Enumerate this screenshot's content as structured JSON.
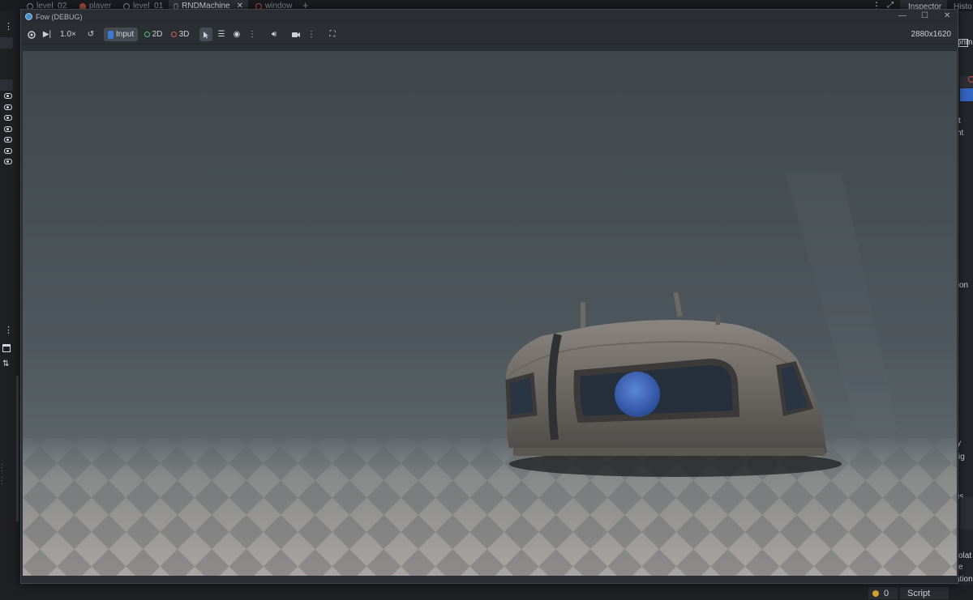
{
  "editor_tabs": [
    {
      "label": "level_02",
      "icon": "scene-icon"
    },
    {
      "label": "player",
      "icon": "person-icon"
    },
    {
      "label": "level_01",
      "icon": "scene-icon"
    },
    {
      "label": "RNDMachine",
      "icon": "scene-icon",
      "active": true,
      "close": "✕"
    },
    {
      "label": "window",
      "icon": "scene-icon-red"
    }
  ],
  "dock_tabs": {
    "inspector": "Inspector",
    "history": "Histo"
  },
  "window": {
    "title": "Fow (DEBUG)",
    "minimize": "—",
    "maximize": "☐",
    "close": "✕"
  },
  "toolbar": {
    "speed": "1.0×",
    "input_label": "Input",
    "mode_2d": "2D",
    "mode_3d": "3D",
    "resolution": "2880x1620"
  },
  "right_dock_fragments": [
    "onme",
    "t",
    "ht",
    "tion",
    "ly",
    "ig",
    "es",
    "olat",
    "e",
    "ation"
  ],
  "status": {
    "warnings": "0",
    "script": "Script"
  },
  "colors": {
    "accent_blue": "#3b7bd6",
    "green": "#56c080",
    "red": "#e05c5c"
  }
}
